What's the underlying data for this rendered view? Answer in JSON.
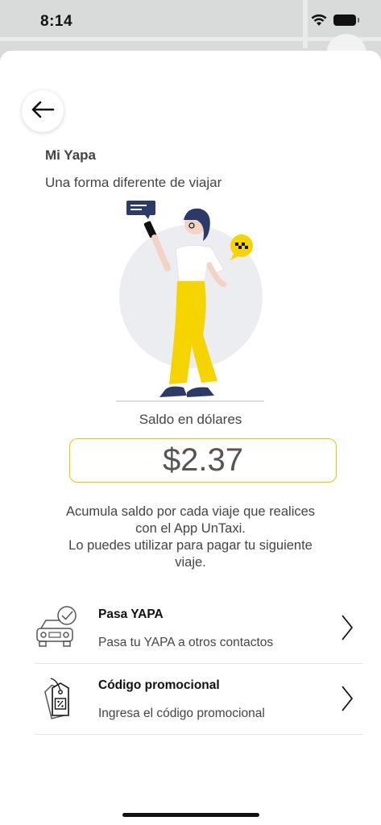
{
  "status_bar": {
    "time": "8:14"
  },
  "header": {
    "title": "Mi Yapa",
    "subtitle": "Una forma diferente de viajar"
  },
  "balance": {
    "label": "Saldo en dólares",
    "value": "$2.37"
  },
  "info": {
    "lines": [
      "Acumula saldo por cada viaje que realices",
      "con el App UnTaxi.",
      "Lo puedes utilizar para pagar tu siguiente",
      "viaje."
    ]
  },
  "options": [
    {
      "title": "Pasa YAPA",
      "description": "Pasa tu YAPA a otros contactos",
      "icon": "car-check-icon"
    },
    {
      "title": "Código promocional",
      "description": "Ingresa el código promocional",
      "icon": "discount-tag-icon"
    }
  ],
  "colors": {
    "accent": "#f5d400",
    "border_accent": "#e6c800",
    "text": "#444444"
  }
}
